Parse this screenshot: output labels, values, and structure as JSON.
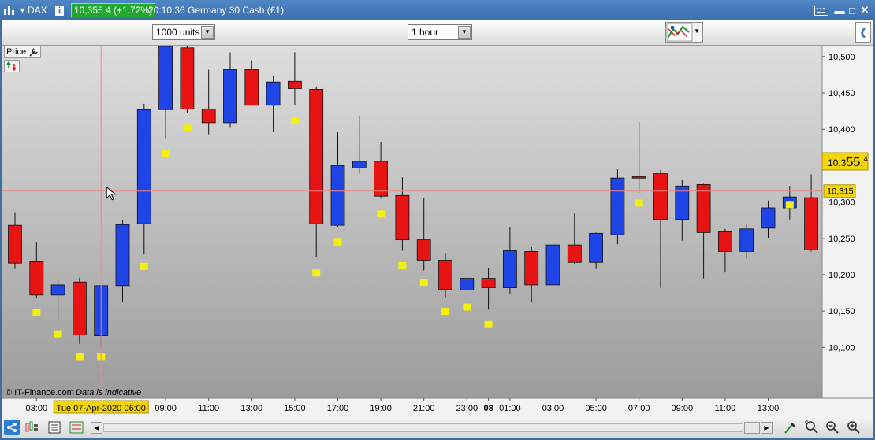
{
  "window": {
    "market_name": "DAX",
    "price_badge": "10,355.4 (+1.72%)",
    "instrument_label": "20:10:36 Germany 30 Cash (£1)",
    "colors": {
      "up": "#1f45e6",
      "down": "#e81414",
      "signal": "#f2ee0e",
      "badge": "#22a82e"
    }
  },
  "toolbar": {
    "units": "1000 units",
    "interval": "1 hour",
    "indicator_icon": "chart-indicators-icon"
  },
  "panel": {
    "price_button": "Price",
    "credit": "© IT-Finance.com",
    "disclaimer": "Data is indicative",
    "crosshair_time": "Tue 07-Apr-2020 06:00",
    "crosshair_price": "10,315",
    "last_price_prefix": "10,3",
    "last_price_big": "55.",
    "last_price_suffix": "4"
  },
  "chart_data": {
    "type": "candlestick",
    "y_ticks": [
      "10,100",
      "10,150",
      "10,200",
      "10,250",
      "10,300",
      "10,350",
      "10,400",
      "10,450",
      "10,500"
    ],
    "ylim": [
      10030,
      10515
    ],
    "x_ticks": [
      {
        "label": "03:00",
        "index": 1
      },
      {
        "label": "09:00",
        "index": 7
      },
      {
        "label": "11:00",
        "index": 9
      },
      {
        "label": "13:00",
        "index": 11
      },
      {
        "label": "15:00",
        "index": 13
      },
      {
        "label": "17:00",
        "index": 15
      },
      {
        "label": "19:00",
        "index": 17
      },
      {
        "label": "21:00",
        "index": 19
      },
      {
        "label": "23:00",
        "index": 21
      },
      {
        "label": "08",
        "index": 22
      },
      {
        "label": "01:00",
        "index": 23
      },
      {
        "label": "03:00",
        "index": 25
      },
      {
        "label": "05:00",
        "index": 27
      },
      {
        "label": "07:00",
        "index": 29
      },
      {
        "label": "09:00",
        "index": 31
      },
      {
        "label": "11:00",
        "index": 33
      },
      {
        "label": "13:00",
        "index": 35
      }
    ],
    "candles": [
      {
        "open": 10268,
        "close": 10216,
        "high": 10286,
        "low": 10208
      },
      {
        "open": 10218,
        "close": 10172,
        "high": 10245,
        "low": 10168
      },
      {
        "open": 10172,
        "close": 10186,
        "high": 10192,
        "low": 10138
      },
      {
        "open": 10190,
        "close": 10117,
        "high": 10196,
        "low": 10105
      },
      {
        "open": 10116,
        "close": 10185,
        "high": 10185,
        "low": 10100
      },
      {
        "open": 10185,
        "close": 10269,
        "high": 10275,
        "low": 10162
      },
      {
        "open": 10270,
        "close": 10427,
        "high": 10435,
        "low": 10228
      },
      {
        "open": 10427,
        "close": 10514,
        "high": 10516,
        "low": 10388
      },
      {
        "open": 10512,
        "close": 10428,
        "high": 10514,
        "low": 10422
      },
      {
        "open": 10428,
        "close": 10409,
        "high": 10482,
        "low": 10393
      },
      {
        "open": 10409,
        "close": 10482,
        "high": 10506,
        "low": 10403
      },
      {
        "open": 10482,
        "close": 10433,
        "high": 10495,
        "low": 10433
      },
      {
        "open": 10433,
        "close": 10465,
        "high": 10474,
        "low": 10396
      },
      {
        "open": 10466,
        "close": 10456,
        "high": 10506,
        "low": 10433
      },
      {
        "open": 10455,
        "close": 10270,
        "high": 10459,
        "low": 10225
      },
      {
        "open": 10268,
        "close": 10350,
        "high": 10396,
        "low": 10265
      },
      {
        "open": 10347,
        "close": 10356,
        "high": 10419,
        "low": 10339
      },
      {
        "open": 10356,
        "close": 10308,
        "high": 10382,
        "low": 10306
      },
      {
        "open": 10309,
        "close": 10248,
        "high": 10334,
        "low": 10233
      },
      {
        "open": 10248,
        "close": 10220,
        "high": 10305,
        "low": 10206
      },
      {
        "open": 10220,
        "close": 10180,
        "high": 10229,
        "low": 10169
      },
      {
        "open": 10179,
        "close": 10195,
        "high": 10196,
        "low": 10178
      },
      {
        "open": 10195,
        "close": 10182,
        "high": 10209,
        "low": 10152
      },
      {
        "open": 10182,
        "close": 10233,
        "high": 10266,
        "low": 10174
      },
      {
        "open": 10232,
        "close": 10186,
        "high": 10238,
        "low": 10162
      },
      {
        "open": 10186,
        "close": 10241,
        "high": 10284,
        "low": 10175
      },
      {
        "open": 10241,
        "close": 10217,
        "high": 10284,
        "low": 10215
      },
      {
        "open": 10217,
        "close": 10257,
        "high": 10258,
        "low": 10208
      },
      {
        "open": 10255,
        "close": 10333,
        "high": 10345,
        "low": 10242
      },
      {
        "open": 10335,
        "close": 10333,
        "high": 10410,
        "low": 10313
      },
      {
        "open": 10339,
        "close": 10276,
        "high": 10344,
        "low": 10182
      },
      {
        "open": 10276,
        "close": 10322,
        "high": 10330,
        "low": 10247
      },
      {
        "open": 10324,
        "close": 10258,
        "high": 10325,
        "low": 10195
      },
      {
        "open": 10259,
        "close": 10232,
        "high": 10263,
        "low": 10203
      },
      {
        "open": 10232,
        "close": 10263,
        "high": 10269,
        "low": 10222
      },
      {
        "open": 10264,
        "close": 10292,
        "high": 10302,
        "low": 10250
      },
      {
        "open": 10292,
        "close": 10307,
        "high": 10322,
        "low": 10276
      },
      {
        "open": 10306,
        "close": 10234,
        "high": 10338,
        "low": 10232
      }
    ],
    "markers": [
      {
        "index": 1,
        "value": 10147
      },
      {
        "index": 2,
        "value": 10118
      },
      {
        "index": 3,
        "value": 10087
      },
      {
        "index": 4,
        "value": 10087
      },
      {
        "index": 6,
        "value": 10211
      },
      {
        "index": 7,
        "value": 10366
      },
      {
        "index": 8,
        "value": 10401
      },
      {
        "index": 13,
        "value": 10411
      },
      {
        "index": 14,
        "value": 10202
      },
      {
        "index": 15,
        "value": 10244
      },
      {
        "index": 17,
        "value": 10283
      },
      {
        "index": 18,
        "value": 10212
      },
      {
        "index": 19,
        "value": 10189
      },
      {
        "index": 20,
        "value": 10149
      },
      {
        "index": 21,
        "value": 10155
      },
      {
        "index": 22,
        "value": 10131
      },
      {
        "index": 29,
        "value": 10298
      },
      {
        "index": 36,
        "value": 10296
      }
    ],
    "last_price": 10355.4,
    "crosshair": {
      "index": 4,
      "value": 10315
    }
  }
}
